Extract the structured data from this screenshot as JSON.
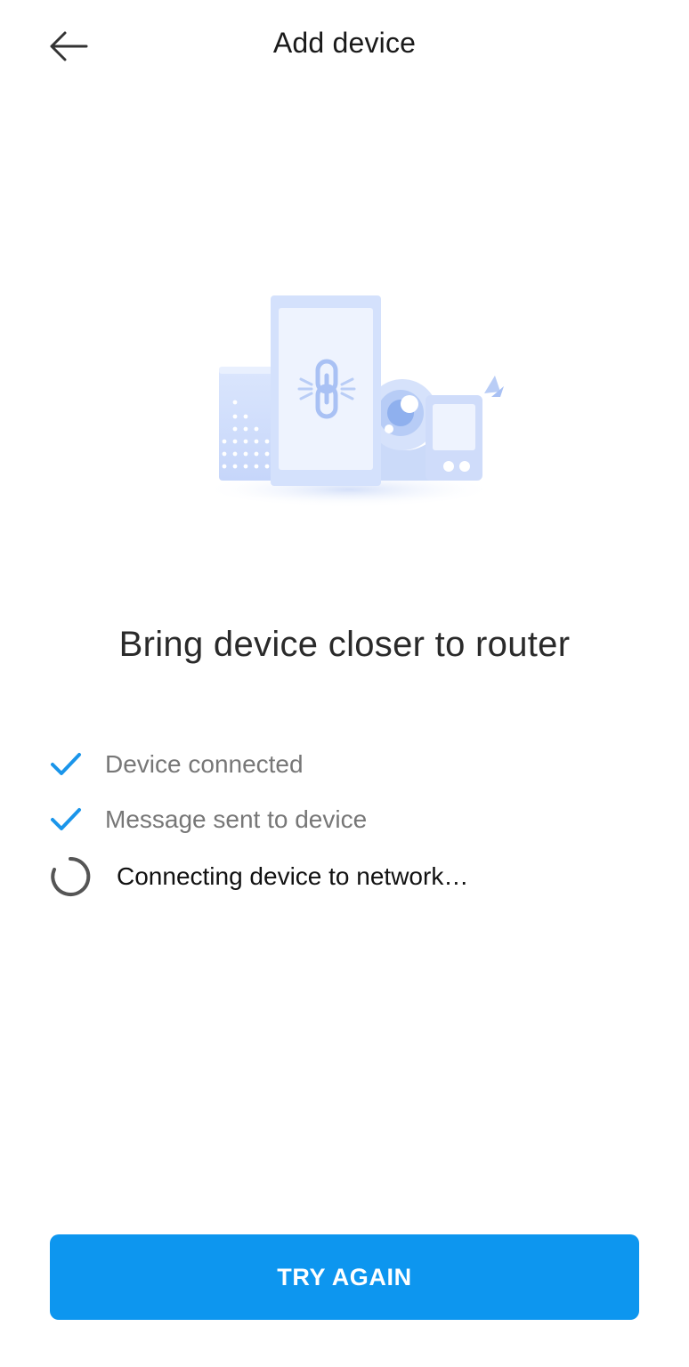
{
  "header": {
    "title": "Add device",
    "back_icon": "arrow-left-icon"
  },
  "illustration": {
    "icons": [
      "speaker-icon",
      "phone-link-icon",
      "camera-icon",
      "display-icon"
    ],
    "colors": {
      "light": "#e8effd",
      "mid": "#c9d9fb",
      "accent": "#9bb5f2"
    }
  },
  "headline": "Bring device closer to router",
  "steps": [
    {
      "label": "Device connected",
      "status": "done",
      "icon": "check-icon"
    },
    {
      "label": "Message sent to device",
      "status": "done",
      "icon": "check-icon"
    },
    {
      "label": "Connecting device to network…",
      "status": "in-progress",
      "icon": "spinner-icon"
    }
  ],
  "actions": {
    "try_again_label": "TRY AGAIN"
  },
  "colors": {
    "accent": "#0d96ef",
    "check": "#1a95ea",
    "text_muted": "#777777",
    "text_strong": "#111111"
  }
}
